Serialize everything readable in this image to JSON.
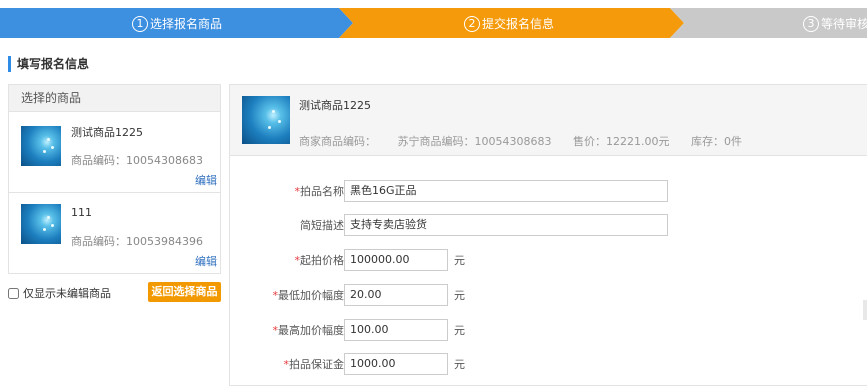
{
  "steps": [
    {
      "num": "1",
      "label": "选择报名商品",
      "color": "#3d8fe0"
    },
    {
      "num": "2",
      "label": "提交报名信息",
      "color": "#f49a0b"
    },
    {
      "num": "3",
      "label": "等待审核",
      "color": "#c9c9c9"
    }
  ],
  "section_title": "填写报名信息",
  "left_panel": {
    "header": "选择的商品",
    "items": [
      {
        "name": "测试商品1225",
        "code": "商品编码：10054308683",
        "edit": "编辑"
      },
      {
        "name": "111",
        "code": "商品编码：10053984396",
        "edit": "编辑"
      }
    ],
    "only_unedited": "仅显示未编辑商品",
    "back_button": "返回选择商品"
  },
  "right_panel": {
    "product_name": "测试商品1225",
    "merchant_code": "商家商品编码：",
    "suning_code": "苏宁商品编码：10054308683",
    "price": "售价：12221.00元",
    "stock": "库存：0件",
    "form": {
      "auction_name": {
        "label": "拍品名称：",
        "value": "黑色16G正品"
      },
      "short_desc": {
        "label": "简短描述：",
        "value": "支持专卖店验货"
      },
      "start_price": {
        "label": "起拍价格：",
        "value": "100000.00",
        "unit": "元"
      },
      "min_increment": {
        "label": "最低加价幅度：",
        "value": "20.00",
        "unit": "元"
      },
      "max_increment": {
        "label": "最高加价幅度：",
        "value": "100.00",
        "unit": "元"
      },
      "deposit": {
        "label": "拍品保证金：",
        "value": "1000.00",
        "unit": "元"
      },
      "required_mark": "*"
    }
  }
}
